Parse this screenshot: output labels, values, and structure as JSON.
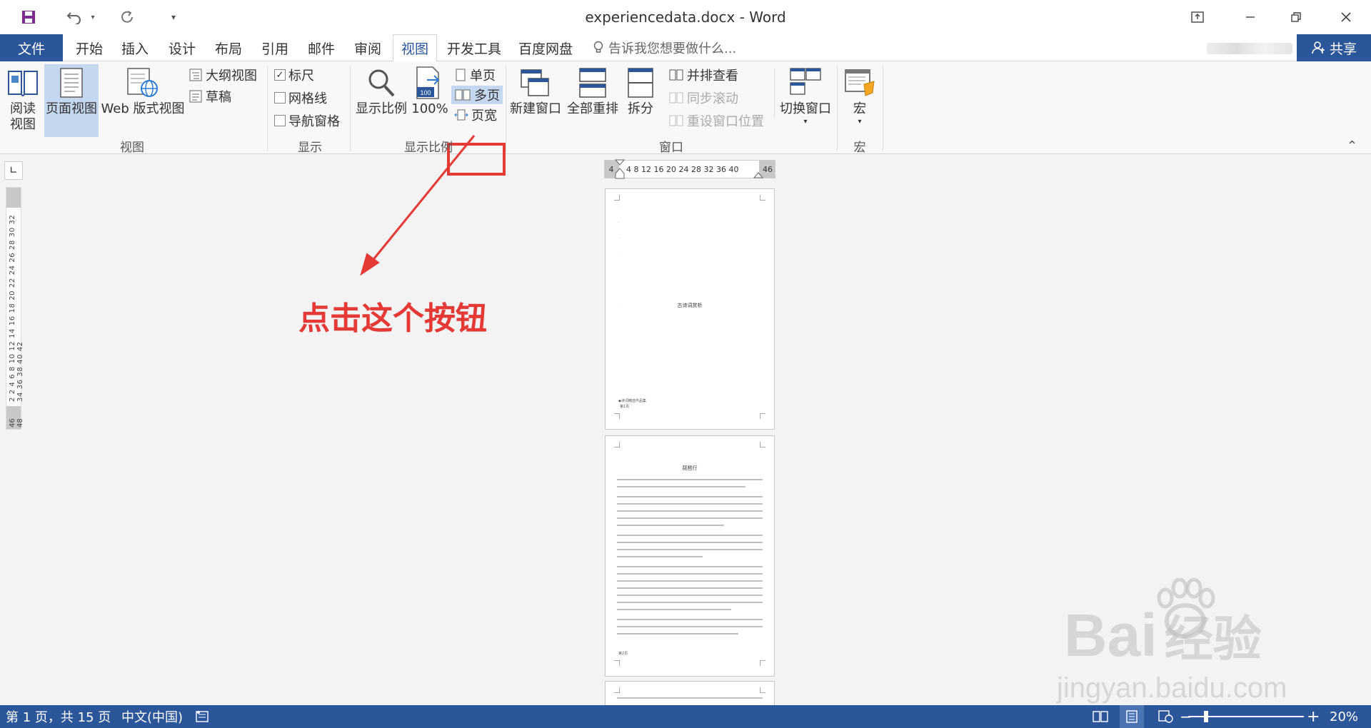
{
  "titlebar": {
    "title": "experiencedata.docx - Word"
  },
  "tabs": {
    "file": "文件",
    "items": [
      "开始",
      "插入",
      "设计",
      "布局",
      "引用",
      "邮件",
      "审阅",
      "视图",
      "开发工具",
      "百度网盘"
    ],
    "active": "视图",
    "tellme": "告诉我您想要做什么...",
    "share": "共享"
  },
  "ribbon": {
    "views": {
      "read_mode": "阅读\n视图",
      "read_line1": "阅读",
      "read_line2": "视图",
      "print_layout": "页面视图",
      "web_layout": "Web 版式视图",
      "outline": "大纲视图",
      "draft": "草稿",
      "group": "视图"
    },
    "show": {
      "ruler": "标尺",
      "ruler_checked": true,
      "gridlines": "网格线",
      "gridlines_checked": false,
      "nav_pane": "导航窗格",
      "nav_pane_checked": false,
      "group": "显示"
    },
    "zoom": {
      "zoom": "显示比例",
      "hundred": "100%",
      "hundred_icon_text": "100",
      "one_page": "单页",
      "multiple_pages": "多页",
      "page_width": "页宽",
      "group": "显示比例"
    },
    "window": {
      "new_window": "新建窗口",
      "arrange_all": "全部重排",
      "split": "拆分",
      "side_by_side": "并排查看",
      "sync_scroll": "同步滚动",
      "reset_position": "重设窗口位置",
      "switch_windows": "切换窗口",
      "group": "窗口"
    },
    "macros": {
      "macros": "宏",
      "group": "宏"
    }
  },
  "rulers": {
    "vertical_text": "2 2 4 6 8 10 12 14 16 18 20 22 24 26 28 30 32 34 36 38 40 42",
    "vertical_end": "46 48",
    "horizontal_left": "4",
    "horizontal_text": "4   8  12  16  20  24  28  32  36  40",
    "horizontal_right": "46"
  },
  "pages": {
    "page1_title": "古诗词赏析",
    "page1_footer": "◆诗词精选作品集",
    "page1_footer2": "第1页",
    "page2_title": "琵琶行",
    "page2_footer": "第2页"
  },
  "annotation": {
    "text": "点击这个按钮"
  },
  "watermark": {
    "brand": "Bai",
    "brand_cn": "经验",
    "url": "jingyan.baidu.com"
  },
  "statusbar": {
    "page": "第 1 页，共 15 页",
    "language": "中文(中国)",
    "zoom_minus": "−",
    "zoom_plus": "+",
    "zoom_level": "20%"
  },
  "colors": {
    "accent": "#2b579a",
    "highlight": "#e53935",
    "selected_view": "#c5d7ef"
  }
}
